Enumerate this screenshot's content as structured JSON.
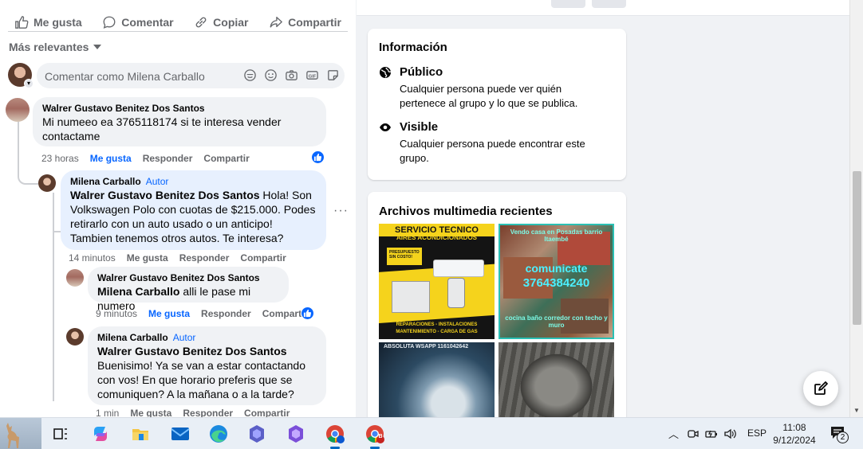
{
  "post_actions": {
    "like": "Me gusta",
    "comment": "Comentar",
    "copy": "Copiar",
    "share": "Compartir"
  },
  "sort_label": "Más relevantes",
  "composer": {
    "placeholder": "Comentar como Milena Carballo"
  },
  "comments": [
    {
      "author": "Walrer Gustavo Benitez Dos Santos",
      "text": "Mi numeeo ea 3765118174 si te interesa vender contactame",
      "time": "23 horas",
      "like": "Me gusta",
      "reply": "Responder",
      "share": "Compartir"
    },
    {
      "author": "Milena Carballo",
      "badge": "Autor",
      "mention": "Walrer Gustavo Benitez Dos Santos",
      "text": " Hola! Son Volkswagen Polo con cuotas de $215.000. Podes retirarlo con un auto usado o un anticipo! Tambien tenemos otros autos. Te interesa?",
      "time": "14 minutos",
      "like": "Me gusta",
      "reply": "Responder",
      "share": "Compartir"
    },
    {
      "author": "Walrer Gustavo Benitez Dos Santos",
      "mention": "Milena Carballo",
      "text": " alli le pase mi numero",
      "time": "9 minutos",
      "like": "Me gusta",
      "reply": "Responder",
      "share": "Compartir"
    },
    {
      "author": "Milena Carballo",
      "badge": "Autor",
      "mention": "Walrer Gustavo Benitez Dos Santos",
      "text": "Buenisimo! Ya se van a estar contactando con vos! En que horario preferis que se comuniquen? A la mañana o a la tarde?",
      "time": "1 min",
      "like": "Me gusta",
      "reply": "Responder",
      "share": "Compartir"
    }
  ],
  "info_card": {
    "title": "Información",
    "public_title": "Público",
    "public_desc": "Cualquier persona puede ver quién pertenece al grupo y lo que se publica.",
    "visible_title": "Visible",
    "visible_desc": "Cualquier persona puede encontrar este grupo."
  },
  "media_card": {
    "title": "Archivos multimedia recientes",
    "items": [
      {
        "line1": "SERVICIO TECNICO",
        "line2": "AIRES ACONDICIONADOS",
        "tag": "PRESUPUESTO SIN COSTO!",
        "footer1": "REPARACIONES - INSTALACIONES",
        "footer2": "MANTENIMIENTO - CARGA DE GAS"
      },
      {
        "top": "Vendo casa en Posadas barrio Itaembé",
        "mid": "comunicate",
        "phone": "3764384240",
        "bottom": "cocina baño corredor con techo y muro"
      },
      {
        "top": "ABSOLUTA WSAPP 1161042642"
      },
      {}
    ]
  },
  "taskbar": {
    "lang": "ESP",
    "time": "11:08",
    "date": "9/12/2024",
    "notif_count": "2",
    "chrome_badge": "B"
  },
  "colors": {
    "accent": "#0866ff",
    "muted": "#65676b",
    "bubble": "#f0f2f5"
  }
}
